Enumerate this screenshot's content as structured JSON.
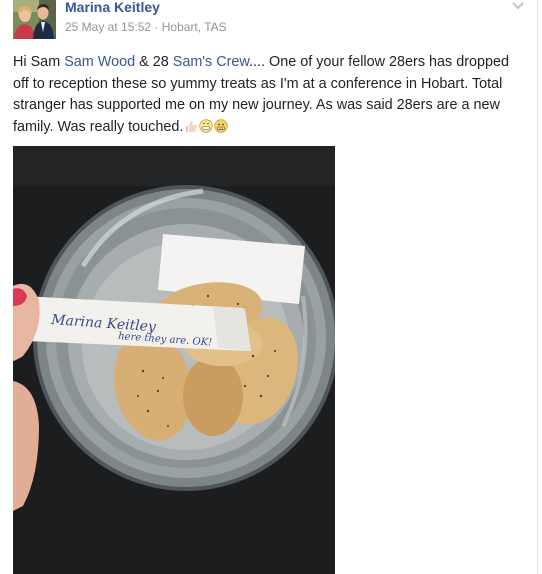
{
  "post": {
    "author": "Marina Keitley",
    "timestamp": "25 May at 15:52",
    "separator": "·",
    "location": "Hobart, TAS",
    "text_hi": "Hi Sam ",
    "tag_sam": "Sam Wood",
    "text_and": " & 28 ",
    "tag_crew": "Sam's Crew",
    "text_body": ".... One of your fellow 28ers has dropped off to reception these so yummy treats as I'm at a conference in Hobart. Total stranger has supported me on my new journey. As was said 28ers are a new family. Was really touched.",
    "emojis": [
      "thumbs-up-icon",
      "grin-icon",
      "grimace-icon"
    ],
    "photo_note_line1": "Marina Keitley",
    "photo_note_line2": "here they are. OK!"
  },
  "colors": {
    "link": "#365899",
    "meta": "#90949c",
    "text": "#1d2129"
  }
}
